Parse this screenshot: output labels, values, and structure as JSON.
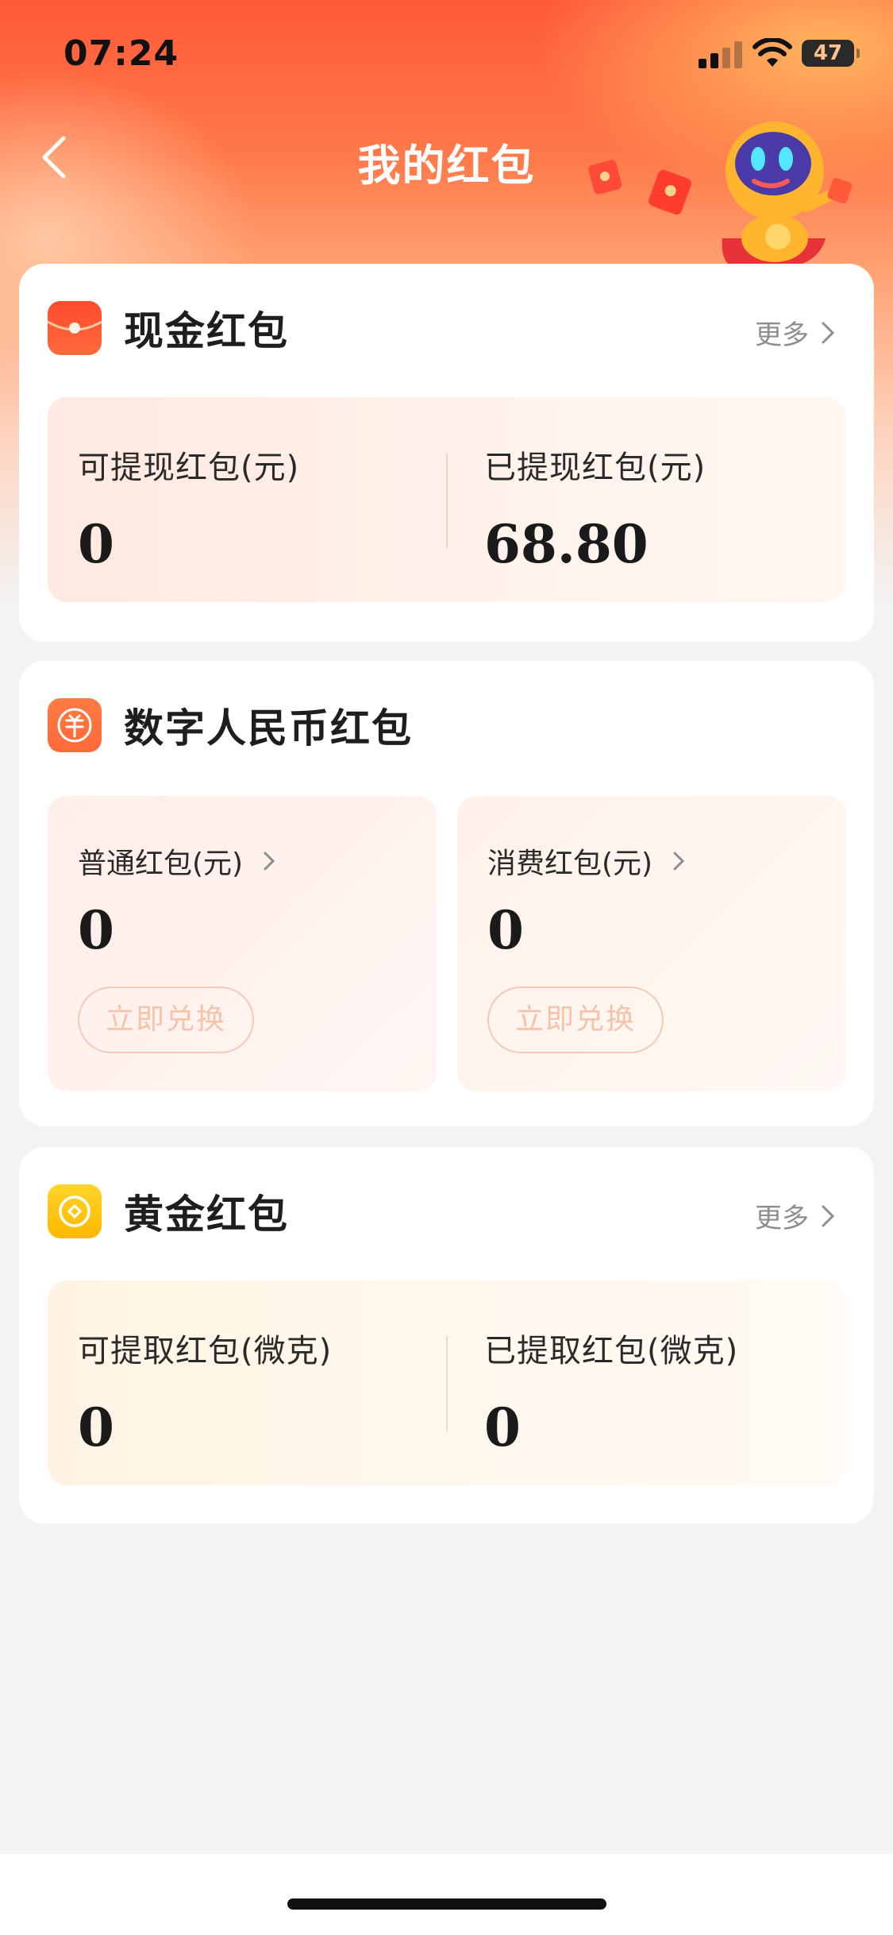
{
  "status_bar": {
    "time": "07:24",
    "battery": "47"
  },
  "nav": {
    "title": "我的红包"
  },
  "cash_card": {
    "title": "现金红包",
    "more": "更多",
    "withdrawable_label": "可提现红包(元)",
    "withdrawable_value": "0",
    "withdrawn_label": "已提现红包(元)",
    "withdrawn_value": "68.80",
    "icon": "red-envelope-icon"
  },
  "digital_card": {
    "title": "数字人民币红包",
    "icon": "digital-rmb-icon",
    "normal": {
      "label": "普通红包(元)",
      "value": "0",
      "button": "立即兑换"
    },
    "consume": {
      "label": "消费红包(元)",
      "value": "0",
      "button": "立即兑换"
    }
  },
  "gold_card": {
    "title": "黄金红包",
    "more": "更多",
    "withdrawable_label": "可提取红包(微克)",
    "withdrawable_value": "0",
    "withdrawn_label": "已提取红包(微克)",
    "withdrawn_value": "0",
    "icon": "gold-coin-icon"
  },
  "colors": {
    "header_start": "#ff5a3a",
    "header_end": "#fdd6c2",
    "page_bg": "#f3f3f3",
    "exchange_border": "#f6c9b4",
    "gold": "#ffc800"
  }
}
